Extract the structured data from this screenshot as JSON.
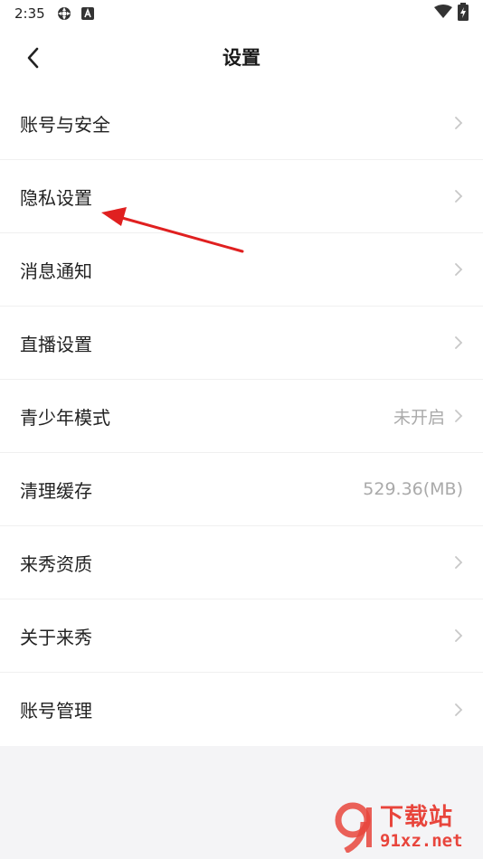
{
  "status_bar": {
    "time": "2:35",
    "icons": [
      "settings-gear-icon",
      "a-badge-icon",
      "wifi-icon",
      "battery-charging-icon"
    ]
  },
  "header": {
    "title": "设置",
    "back_icon": "chevron-left-icon"
  },
  "settings": {
    "items": [
      {
        "label": "账号与安全",
        "value": "",
        "has_chevron": true
      },
      {
        "label": "隐私设置",
        "value": "",
        "has_chevron": true
      },
      {
        "label": "消息通知",
        "value": "",
        "has_chevron": true
      },
      {
        "label": "直播设置",
        "value": "",
        "has_chevron": true
      },
      {
        "label": "青少年模式",
        "value": "未开启",
        "has_chevron": true
      },
      {
        "label": "清理缓存",
        "value": "529.36(MB)",
        "has_chevron": false
      },
      {
        "label": "来秀资质",
        "value": "",
        "has_chevron": true
      },
      {
        "label": "关于来秀",
        "value": "",
        "has_chevron": true
      },
      {
        "label": "账号管理",
        "value": "",
        "has_chevron": true
      }
    ]
  },
  "annotation": {
    "arrow_color": "#e02020",
    "points_to": "隐私设置"
  },
  "watermark": {
    "cn_text": "下载站",
    "url_text": "91xz.net",
    "color": "#e8453c"
  }
}
